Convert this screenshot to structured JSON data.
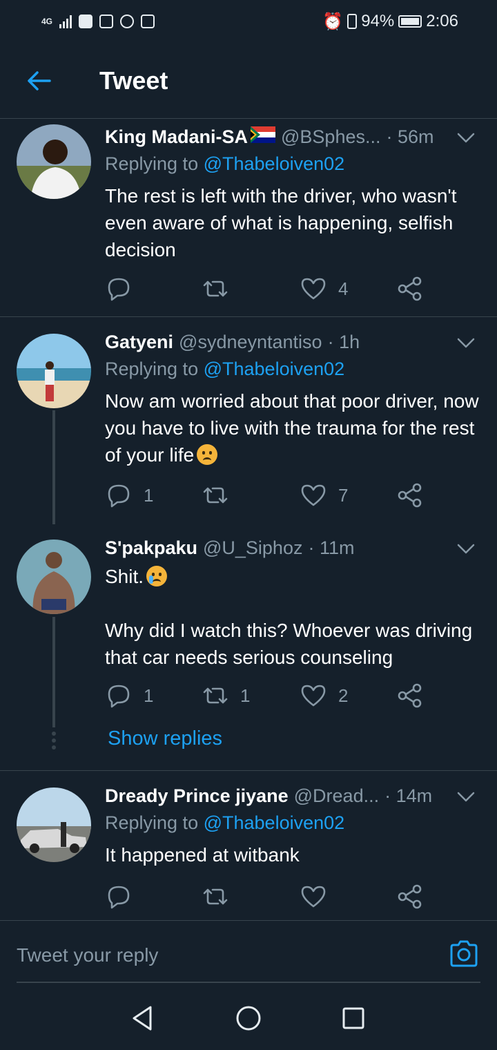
{
  "status_bar": {
    "network": "4G",
    "battery_pct": "94%",
    "time": "2:06"
  },
  "header": {
    "title": "Tweet"
  },
  "tweets": [
    {
      "name": "King Madani-SA",
      "handle": "@BSphes...",
      "time": "· 56m",
      "replying_prefix": "Replying to",
      "replying_to": "@Thabeloiven02",
      "text": "The rest is left with the driver, who wasn't even aware of what is happening, selfish decision",
      "replies": "",
      "retweets": "",
      "likes": "4"
    },
    {
      "name": "Gatyeni",
      "handle": "@sydneyntantiso",
      "time": "· 1h",
      "replying_prefix": "Replying to",
      "replying_to": "@Thabeloiven02",
      "text": "Now am worried about that poor driver, now you have to live with the trauma for the rest of your life",
      "replies": "1",
      "retweets": "",
      "likes": "7"
    },
    {
      "name": "S'pakpaku",
      "handle": "@U_Siphoz",
      "time": "· 11m",
      "text": "Shit.",
      "text2": "Why did I watch this? Whoever was driving that car needs serious counseling",
      "replies": "1",
      "retweets": "1",
      "likes": "2"
    },
    {
      "name": "Dready Prince jiyane",
      "handle": "@Dread...",
      "time": "· 14m",
      "replying_prefix": "Replying to",
      "replying_to": "@Thabeloiven02",
      "text": "It happened at witbank",
      "replies": "",
      "retweets": "",
      "likes": ""
    }
  ],
  "show_replies_label": "Show replies",
  "reply_bar": {
    "placeholder": "Tweet your reply"
  },
  "colors": {
    "background": "#15202b",
    "accent": "#1da1f2",
    "secondary_text": "#8899a6",
    "divider": "#38444d"
  },
  "icons": [
    "back-arrow-icon",
    "chevron-down-icon",
    "reply-icon",
    "retweet-icon",
    "like-icon",
    "share-icon",
    "camera-icon",
    "nav-back-icon",
    "nav-home-icon",
    "nav-recents-icon"
  ]
}
